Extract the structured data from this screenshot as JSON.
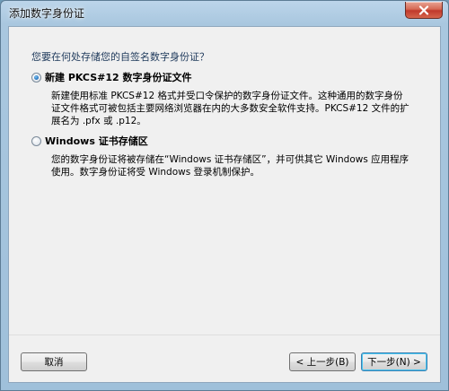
{
  "window": {
    "title": "添加数字身份证"
  },
  "content": {
    "question": "您要在何处存储您的自签名数字身份证？",
    "options": [
      {
        "label": "新建 PKCS#12 数字身份证文件",
        "selected": true,
        "description": "新建使用标准 PKCS#12 格式并受口令保护的数字身份证文件。这种通用的数字身份证文件格式可被包括主要网络浏览器在内的大多数安全软件支持。PKCS#12 文件的扩展名为 .pfx 或 .p12。"
      },
      {
        "label": "Windows 证书存储区",
        "selected": false,
        "description": "您的数字身份证将被存储在“Windows 证书存储区”，并可供其它 Windows 应用程序使用。数字身份证将受 Windows 登录机制保护。"
      }
    ]
  },
  "buttons": {
    "cancel": "取消",
    "back": "< 上一步(B)",
    "next": "下一步(N) >"
  },
  "icons": {
    "close": "close-icon"
  }
}
